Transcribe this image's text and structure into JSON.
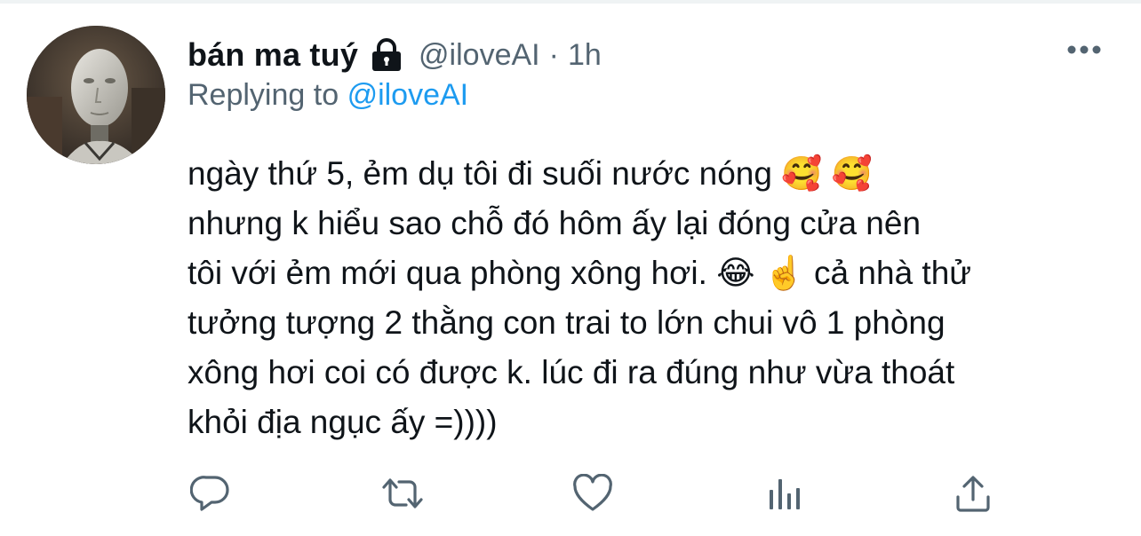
{
  "tweet": {
    "display_name": "bán ma tuý",
    "handle": "@iloveAI",
    "separator": "·",
    "time": "1h",
    "replying_prefix": "Replying to",
    "replying_handle": "@iloveAI",
    "body_lines": [
      "ngày thứ 5, ẻm dụ tôi đi suối nước nóng 🥰 🥰",
      "nhưng k hiểu sao chỗ đó hôm ấy lại đóng cửa nên",
      "tôi với ẻm mới qua phòng xông hơi. 😂 ☝️  cả nhà thử",
      "tưởng tượng 2 thằng con trai to lớn chui vô 1 phòng",
      "xông hơi coi có được k. lúc đi ra đúng như vừa thoát",
      "khỏi địa ngục ấy =))))"
    ]
  },
  "icons": {
    "lock": "lock-icon",
    "more": "more-icon",
    "reply": "reply-icon",
    "retweet": "retweet-icon",
    "like": "like-icon",
    "analytics": "analytics-icon",
    "share": "share-icon"
  },
  "colors": {
    "text_primary": "#0f1419",
    "text_secondary": "#536471",
    "accent": "#1d9bf0"
  }
}
